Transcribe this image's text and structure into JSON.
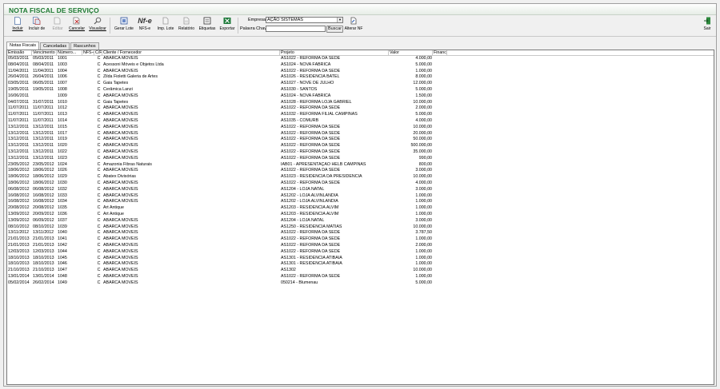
{
  "window": {
    "title": "NOTA FISCAL DE SERVIÇO"
  },
  "toolbar": {
    "incluir": "Incluir",
    "incluir_de": "Incluir de",
    "editar": "Editar",
    "cancelar": "Cancelar",
    "visualizar": "Visualizar",
    "gerar_lote": "Gerar Lote",
    "nfse": "NFS-e",
    "nfe_logo": "Nf-e",
    "imp_lote": "Imp. Lote",
    "relatorio": "Relatório",
    "etiquetas": "Etiquetas",
    "exportar": "Exportar",
    "alterar_nf": "Alterar NF",
    "sair": "Sair"
  },
  "filters": {
    "empresa_label": "Empresa",
    "empresa_value": "AÇÃO SISTEMAS",
    "palavra_label": "Palavra Chave",
    "palavra_value": "",
    "buscar": "Buscar"
  },
  "tabs": [
    "Notas Fiscais",
    "Canceladas",
    "Rascunhos"
  ],
  "table": {
    "headers": [
      "Emissão",
      "Vencimento",
      "Número...",
      "NFS-e",
      "C/F",
      "Cliente / Fornecedor",
      "Projeto",
      "Valor",
      "Financ"
    ],
    "rows": [
      [
        "05/03/2011",
        "05/03/2011",
        "1001",
        "",
        "C",
        "ABARCA MÓVEIS",
        "AS1022 - REFORMA DA SEDE",
        "4.000,00",
        ""
      ],
      [
        "08/04/2011",
        "08/04/2011",
        "1003",
        "",
        "C",
        "Acessoni Móveis e Objetos Ltda",
        "AS1024 - NOVA FÁBRICA",
        "5.000,00",
        ""
      ],
      [
        "11/04/2011",
        "11/04/2011",
        "1004",
        "",
        "C",
        "ABARCA MÓVEIS",
        "AS1022 - REFORMA DA SEDE",
        "1.000,00",
        ""
      ],
      [
        "26/04/2011",
        "26/04/2011",
        "1006",
        "",
        "C",
        "Zilda Fioletti  Galeria de  Artes",
        "AS1026 - RESIDENCIA BATEL",
        "8.000,00",
        ""
      ],
      [
        "03/05/2011",
        "06/05/2011",
        "1007",
        "",
        "C",
        "Gaia Tapetes",
        "AS1027 - NOVE DE JULHO",
        "12.000,00",
        ""
      ],
      [
        "19/05/2011",
        "19/05/2011",
        "1008",
        "",
        "C",
        "Cerâmica Lanzi",
        "AS1030 - SANTOS",
        "5.000,00",
        ""
      ],
      [
        "16/06/2011",
        "",
        "1009",
        "",
        "C",
        "ABARCA MÓVEIS",
        "AS1024 - NOVA FÁBRICA",
        "1.500,00",
        ""
      ],
      [
        "04/07/2011",
        "31/07/2011",
        "1010",
        "",
        "C",
        "Gaia Tapetes",
        "AS1028 - REFORMA LOJA GABRIEL",
        "10.000,00",
        ""
      ],
      [
        "11/07/2011",
        "11/07/2011",
        "1012",
        "",
        "C",
        "ABARCA MÓVEIS",
        "AS1022 - REFORMA DA SEDE",
        "2.000,00",
        ""
      ],
      [
        "11/07/2011",
        "11/07/2011",
        "1013",
        "",
        "C",
        "ABARCA MÓVEIS",
        "AS1032 - REFORMA FILIAL CAMPINAS",
        "5.000,00",
        ""
      ],
      [
        "11/07/2011",
        "11/07/2011",
        "1014",
        "",
        "C",
        "ABARCA MÓVEIS",
        "AS1035 - COMURB",
        "4.000,00",
        ""
      ],
      [
        "13/12/2011",
        "13/12/2011",
        "1015",
        "",
        "C",
        "ABARCA MÓVEIS",
        "AS1022 - REFORMA DA SEDE",
        "10.000,00",
        ""
      ],
      [
        "13/12/2011",
        "13/12/2011",
        "1017",
        "",
        "C",
        "ABARCA MÓVEIS",
        "AS1022 - REFORMA DA SEDE",
        "20.000,00",
        ""
      ],
      [
        "13/12/2011",
        "13/12/2011",
        "1019",
        "",
        "C",
        "ABARCA MÓVEIS",
        "AS1022 - REFORMA DA SEDE",
        "50.000,00",
        ""
      ],
      [
        "13/12/2011",
        "13/12/2011",
        "1020",
        "",
        "C",
        "ABARCA MÓVEIS",
        "AS1022 - REFORMA DA SEDE",
        "500.000,00",
        ""
      ],
      [
        "13/12/2011",
        "13/12/2011",
        "1022",
        "",
        "C",
        "ABARCA MÓVEIS",
        "AS1022 - REFORMA DA SEDE",
        "35.000,00",
        ""
      ],
      [
        "13/12/2011",
        "13/12/2011",
        "1023",
        "",
        "C",
        "ABARCA MÓVEIS",
        "AS1022 - REFORMA DA SEDE",
        "990,00",
        ""
      ],
      [
        "23/05/2012",
        "23/05/2012",
        "1024",
        "",
        "C",
        "Amazonia Fibras Naturais",
        "IAB01 - APRESENTAÇÃO HELB CAMPINAS",
        "800,00",
        ""
      ],
      [
        "18/06/2012",
        "18/06/2012",
        "1026",
        "",
        "C",
        "ABARCA MÓVEIS",
        "AS1022 - REFORMA DA SEDE",
        "3.000,00",
        ""
      ],
      [
        "18/06/2012",
        "18/06/2012",
        "1029",
        "",
        "C",
        "Abatex Divisórias",
        "AS1023 - RESIDENCIA DA PRESIDENCIA",
        "10.000,00",
        ""
      ],
      [
        "18/06/2012",
        "18/06/2012",
        "1030",
        "",
        "C",
        "ABARCA MÓVEIS",
        "AS1022 - REFORMA DA SEDE",
        "4.000,00",
        ""
      ],
      [
        "06/08/2012",
        "06/08/2012",
        "1032",
        "",
        "C",
        "ABARCA MÓVEIS",
        "AS1204 - LOJA NATAL",
        "3.000,00",
        ""
      ],
      [
        "16/08/2012",
        "16/08/2012",
        "1033",
        "",
        "C",
        "ABARCA MÓVEIS",
        "AS1202 - LOJA ALVINLANDIA",
        "1.000,00",
        ""
      ],
      [
        "16/08/2012",
        "16/08/2012",
        "1034",
        "",
        "C",
        "ABARCA MÓVEIS",
        "AS1202 - LOJA ALVINLANDIA",
        "1.000,00",
        ""
      ],
      [
        "20/08/2012",
        "20/08/2012",
        "1035",
        "",
        "C",
        "Art Antique",
        "AS1203 - RESIDENCIA ALVIM",
        "1.000,00",
        ""
      ],
      [
        "13/09/2012",
        "20/09/2012",
        "1036",
        "",
        "C",
        "Art Antique",
        "AS1203 - RESIDENCIA ALVIM",
        "1.000,00",
        ""
      ],
      [
        "13/09/2012",
        "06/09/2012",
        "1037",
        "",
        "C",
        "ABARCA MÓVEIS",
        "AS1204 - LOJA NATAL",
        "3.000,00",
        ""
      ],
      [
        "08/10/2012",
        "08/10/2012",
        "1039",
        "",
        "C",
        "ABARCA MÓVEIS",
        "AS1250 - RESIDENCIA MATIAS",
        "10.000,00",
        ""
      ],
      [
        "13/11/2012",
        "13/11/2012",
        "1040",
        "",
        "C",
        "ABARCA MÓVEIS",
        "AS1022 - REFORMA DA SEDE",
        "3.787,50",
        ""
      ],
      [
        "21/01/2013",
        "21/01/2013",
        "1041",
        "",
        "C",
        "ABARCA MÓVEIS",
        "AS1022 - REFORMA DA SEDE",
        "1.000,00",
        ""
      ],
      [
        "21/01/2013",
        "21/01/2013",
        "1042",
        "",
        "C",
        "ABARCA MÓVEIS",
        "AS1022 - REFORMA DA SEDE",
        "2.000,00",
        ""
      ],
      [
        "12/03/2013",
        "12/03/2013",
        "1044",
        "",
        "C",
        "ABARCA MÓVEIS",
        "AS1022 - REFORMA DA SEDE",
        "1.000,00",
        ""
      ],
      [
        "18/10/2013",
        "18/10/2013",
        "1045",
        "",
        "C",
        "ABARCA MÓVEIS",
        "AS1301 - RESIDENCIA ATIBAIA",
        "1.000,00",
        ""
      ],
      [
        "18/10/2013",
        "18/10/2013",
        "1046",
        "",
        "C",
        "ABARCA MÓVEIS",
        "AS1301 - RESIDENCIA ATIBAIA",
        "1.000,00",
        ""
      ],
      [
        "21/10/2013",
        "21/10/2013",
        "1047",
        "",
        "C",
        "ABARCA MÓVEIS",
        "AS1302",
        "10.000,00",
        ""
      ],
      [
        "13/01/2014",
        "13/01/2014",
        "1048",
        "",
        "C",
        "ABARCA MÓVEIS",
        "AS1022 - REFORMA DA SEDE",
        "1.000,00",
        ""
      ],
      [
        "05/02/2014",
        "26/02/2014",
        "1049",
        "",
        "C",
        "ABARCA MÓVEIS",
        "050214 - Blumenau",
        "5.000,00",
        ""
      ]
    ]
  }
}
